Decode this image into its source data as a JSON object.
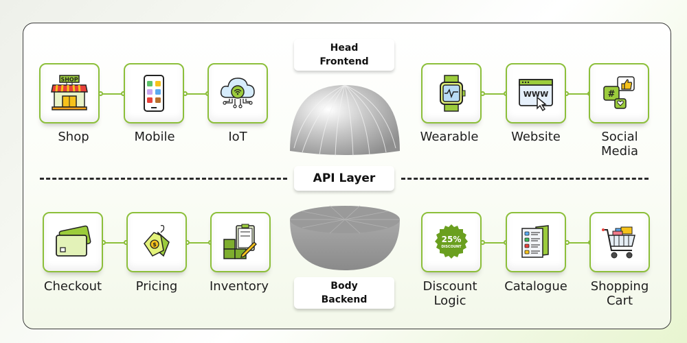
{
  "labels": {
    "head": "Head",
    "frontend": "Frontend",
    "api_layer": "API Layer",
    "body": "Body",
    "backend": "Backend"
  },
  "frontend_nodes": [
    {
      "label": "Shop",
      "icon": "shop-icon"
    },
    {
      "label": "Mobile",
      "icon": "mobile-icon"
    },
    {
      "label": "IoT",
      "icon": "iot-cloud-icon"
    },
    {
      "label": "Wearable",
      "icon": "smartwatch-icon"
    },
    {
      "label": "Website",
      "icon": "website-icon"
    },
    {
      "label_line1": "Social",
      "label_line2": "Media",
      "icon": "social-media-icon"
    }
  ],
  "backend_nodes": [
    {
      "label": "Checkout",
      "icon": "credit-card-icon"
    },
    {
      "label": "Pricing",
      "icon": "price-tag-icon"
    },
    {
      "label": "Inventory",
      "icon": "inventory-icon"
    },
    {
      "label_line1": "Discount",
      "label_line2": "Logic",
      "icon": "discount-badge-icon",
      "badge_pct": "25%",
      "badge_text": "DISCOUNT"
    },
    {
      "label": "Catalogue",
      "icon": "catalogue-icon"
    },
    {
      "label_line1": "Shopping",
      "label_line2": "Cart",
      "icon": "shopping-cart-icon"
    }
  ],
  "shop_sign": "SHOP",
  "website_text": "WWW",
  "hash": "#",
  "colors": {
    "accent": "#8cbf3a",
    "dark_green": "#5e9a1e",
    "text": "#1d1d1d"
  }
}
